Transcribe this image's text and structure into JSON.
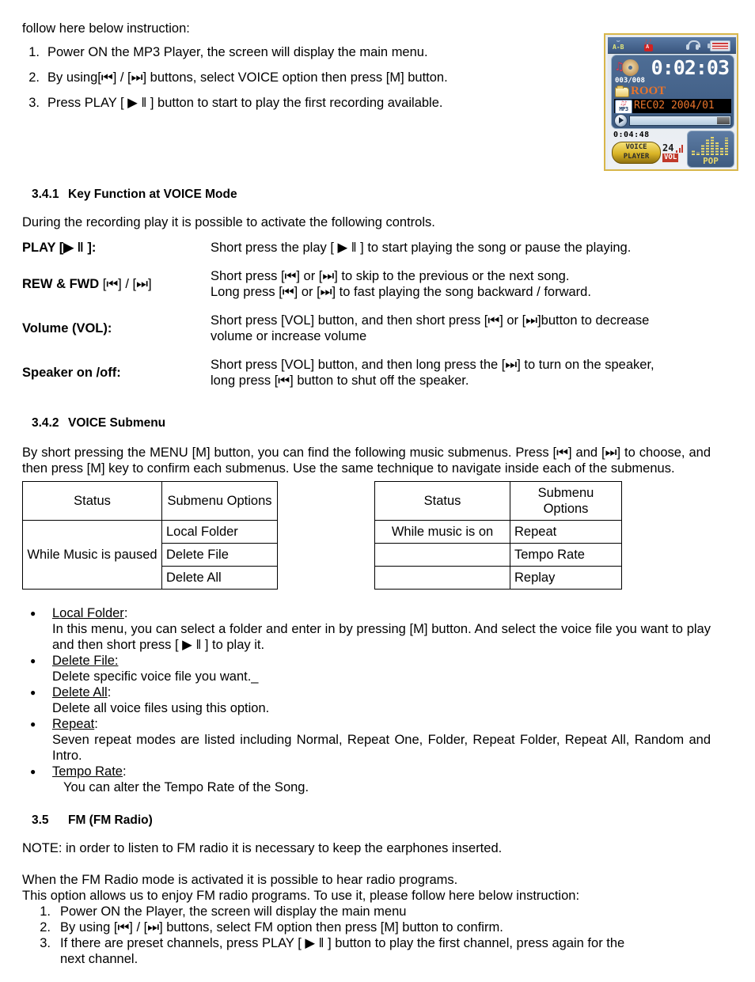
{
  "intro": {
    "lead": "follow here below instruction:",
    "steps": [
      {
        "num": "1.",
        "text": "Power ON the MP3 Player, the screen will display the main menu."
      },
      {
        "num": "2.",
        "text": "By using[⏮] / [⏭] buttons, select VOICE option then press [M] button."
      },
      {
        "num": "3.",
        "text": "Press PLAY [ ▶ ‖ ] button to start to play the first recording available."
      }
    ]
  },
  "device": {
    "status_icons": {
      "ab_label": "A-B",
      "ab_arc": "↷",
      "record_icon": "record-icon",
      "headphone_icon": "headphone-icon",
      "battery_icon": "battery-icon"
    },
    "time": "0:02:03",
    "track_counter": "003/008",
    "folder": "ROOT",
    "file_badge": "MP3",
    "file_name": "REC02  2004/01",
    "rec_time": "0:04:48",
    "mode_line1": "VOICE",
    "mode_line2": "PLAYER",
    "volume_value": "24",
    "volume_label": "VOL",
    "eq_preset": "POP",
    "colors": {
      "bezel": "#d8b64a",
      "lcd_blue": "#3d5a80",
      "amber_text": "#e8742b",
      "status_bar": "#4b6a93",
      "gold_pill": "#d9b426",
      "eq_yellow": "#e8d76a",
      "vol_red": "#c0392b"
    }
  },
  "section_341": {
    "number": "3.4.1",
    "title": "Key Function at VOICE Mode",
    "intro": "During the recording play it is possible to activate the following controls.",
    "rows": [
      {
        "term_bold": "PLAY [▶ ‖ ]:",
        "term_light": "",
        "desc": [
          "Short press the play [ ▶ ‖ ] to start playing the song or pause the playing."
        ]
      },
      {
        "term_bold": "REW & FWD ",
        "term_light": "[⏮] / [⏭]",
        "desc": [
          "Short press [⏮] or [⏭] to skip to the previous or the next song.",
          "Long press [⏮] or [⏭] to fast playing the song backward / forward."
        ]
      },
      {
        "term_bold": "Volume (VOL):",
        "term_light": "",
        "desc": [
          "Short press [VOL] button, and then short press [⏮] or [⏭]button to decrease",
          "volume or increase volume"
        ]
      },
      {
        "term_bold": "Speaker on /off:",
        "term_light": "",
        "desc": [
          "Short press [VOL] button, and then long press the [⏭] to turn on the speaker,",
          "long press [⏮] button to shut off the speaker."
        ]
      }
    ]
  },
  "section_342": {
    "number": "3.4.2",
    "title": "VOICE Submenu",
    "intro": "By short pressing the MENU [M] button, you can find the following music submenus. Press [⏮] and [⏭] to choose, and then press   [M] key to confirm each submenus. Use the same technique to navigate inside each of the submenus.",
    "table_left": {
      "headers": [
        "Status",
        "Submenu Options"
      ],
      "status_cell": "While Music is paused",
      "options": [
        "Local Folder",
        "Delete File",
        "Delete All"
      ]
    },
    "table_right": {
      "headers": [
        "Status",
        "Submenu Options"
      ],
      "status_cells": [
        "While music is on",
        "",
        ""
      ],
      "options": [
        "Repeat",
        "Tempo Rate",
        "Replay"
      ]
    },
    "bullets": [
      {
        "term": "Local Folder",
        "colon": ":",
        "desc": "In this menu, you can select a folder and enter in by pressing [M] button. And select the voice file you want to play and then short press [ ▶ ‖ ] to play it.",
        "indent": false
      },
      {
        "term": "Delete File:",
        "colon": "",
        "desc": "Delete specific voice file you want._",
        "indent": false
      },
      {
        "term": "Delete All",
        "colon": ":",
        "desc": "Delete all voice files using this option.",
        "indent": false
      },
      {
        "term": "Repeat",
        "colon": ":",
        "desc": "Seven repeat modes are listed including Normal, Repeat One, Folder, Repeat Folder, Repeat All, Random and Intro.",
        "indent": false
      },
      {
        "term": "Tempo Rate",
        "colon": ":",
        "desc": "You can alter the Tempo Rate of the Song.",
        "indent": true
      }
    ]
  },
  "section_35": {
    "number": "3.5",
    "title": "FM (FM Radio)",
    "note": "NOTE: in order to listen to FM radio it is necessary to keep the earphones inserted.",
    "para1": "When the FM Radio mode is activated it is possible to hear radio programs.",
    "para2": "This option allows us to enjoy FM radio programs. To use it, please follow here below instruction:",
    "steps": [
      {
        "num": "1.",
        "text": "Power ON the Player, the screen will display the main menu",
        "cont": ""
      },
      {
        "num": "2.",
        "text": "By using [⏮] / [⏭] buttons, select FM option then press [M] button to confirm.",
        "cont": ""
      },
      {
        "num": "3.",
        "text": "If there are preset channels, press PLAY [ ▶ ‖ ] button to play the first channel, press again for the",
        "cont": "next channel."
      }
    ]
  }
}
